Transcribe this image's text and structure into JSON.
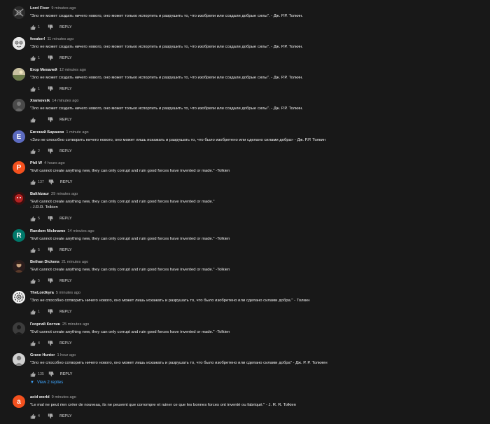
{
  "comments": [
    {
      "author": "Lord Fixer",
      "time": "9 minutes ago",
      "text": "\"Зло не может создать ничего нового, оно может только испортить и разрушить то, что изобрели или создали добрые силы\". - Дж. Р.Р. Толкин.",
      "likes": "1",
      "avatar_color": "#2b2b2b",
      "avatar_icon": "lord-fixer-avatar-icon"
    },
    {
      "author": "feeaker!",
      "time": "11 minutes ago",
      "text": "\"Зло не может создать ничего нового, оно может только испортить и разрушить то, что изобрели или создали добрые силы\". - Дж. Р.Р. Толкин.",
      "likes": "1",
      "avatar_color": "#d9d9d9",
      "avatar_icon": "cartoon-face-avatar-icon"
    },
    {
      "author": "Егор Михалей",
      "time": "12 minutes ago",
      "text": "\"Зло не может создать ничего нового, оно может только испортить и разрушить то, что изобрели или создали добрые силы\". - Дж. Р.Р. Толкин.",
      "likes": "1",
      "avatar_color": "#8a8a6a",
      "avatar_icon": "landscape-avatar-icon"
    },
    {
      "author": "Xramovsik",
      "time": "14 minutes ago",
      "text": "\"Зло не может создать ничего нового, оно может только испортить и разрушить то, что изобрели или создали добрые силы\". - Дж. Р.Р. Толкин.",
      "likes": "",
      "avatar_color": "#555555",
      "avatar_icon": "dark-figure-avatar-icon"
    },
    {
      "author": "Евгений Баранов",
      "time": "1 minute ago",
      "text": "«Зло не способно сотворить ничего нового, оно может лишь искажать и разрушать то, что было изобретено или сделано силами добра» - Дж. Р.Р. Толкин",
      "likes": "2",
      "avatar_color": "#5c6bc0",
      "avatar_letter": "E"
    },
    {
      "author": "Phil W",
      "time": "4 hours ago",
      "text": "\"Evil cannot create anything new, they can only corrupt and ruin good forces have invented or made.\" -Tolkien",
      "likes": "137",
      "avatar_color": "#f4511e",
      "avatar_letter": "P"
    },
    {
      "author": "Balthizaur",
      "time": "29 minutes ago",
      "text": "\"Evil cannot create anything new, they can only corrupt and ruin good forces have invented or made.\"",
      "text2": "- J.R.R. Tolkien",
      "likes": "5",
      "avatar_color": "#8b1a1a",
      "avatar_icon": "red-creature-avatar-icon"
    },
    {
      "author": "Random Nickname",
      "time": "14 minutes ago",
      "text": "\"Evil cannot create anything new, they can only corrupt and ruin good forces have invented or made.\" -Tolkien",
      "likes": "5",
      "avatar_color": "#00796b",
      "avatar_letter": "R"
    },
    {
      "author": "Bethan Dickens",
      "time": "21 minutes ago",
      "text": "\"Evil cannot create anything new, they can only corrupt and ruin good forces have invented or made.\" -Tolkien",
      "likes": "5",
      "avatar_color": "#3a2a2a",
      "avatar_icon": "portrait-avatar-icon"
    },
    {
      "author": "TheLordkyra",
      "time": "5 minutes ago",
      "text": "\"Зло не способно сотворить ничего нового, оно может лишь искажать и разрушать то, что было изобретено или сделано силами добра.\" - Толкин",
      "likes": "1",
      "avatar_color": "#eeeeee",
      "avatar_icon": "spiral-avatar-icon"
    },
    {
      "author": "Георгий Костин",
      "time": "25 minutes ago",
      "text": "\"Evil cannot create anything new, they can only corrupt and ruin good forces have invented or made.\" -Tolkien",
      "likes": "4",
      "avatar_color": "#2f2f2f",
      "avatar_icon": "silhouette-avatar-icon"
    },
    {
      "author": "Grave Hunter",
      "time": "1 hour ago",
      "text": "\"Зло не способно сотворить ничего нового, оно может лишь искажать и разрушать то, что было изобретено или сделано силами добра\" - Дж. Р. Р. Толкиен",
      "likes": "135",
      "avatar_color": "#bdbdbd",
      "avatar_icon": "grey-portrait-avatar-icon",
      "replies_label": "View 2 replies"
    },
    {
      "author": "acid world",
      "time": "9 minutes ago",
      "text": "\"Le mal ne peut rien créer de nouveau, ils ne peuvent que corrompre et ruiner ce que les bonnes forces ont inventé ou fabriqué.\" - J. R. R. Tolkien",
      "likes": "4",
      "avatar_color": "#f4511e",
      "avatar_letter": "a"
    }
  ],
  "ui": {
    "reply_label": "REPLY",
    "like_icon": "thumbs-up-icon",
    "dislike_icon": "thumbs-down-icon",
    "chevron_icon": "chevron-down-icon",
    "background": "#181818",
    "link_color": "#3ea6ff"
  }
}
